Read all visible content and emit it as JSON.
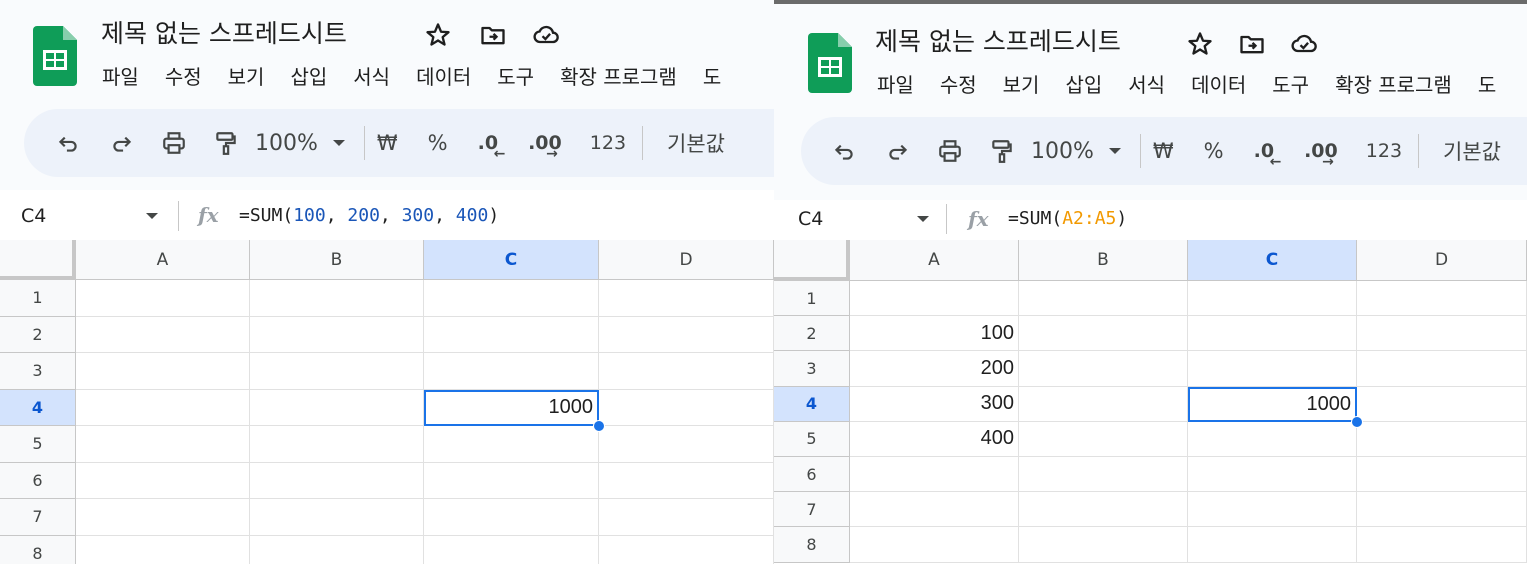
{
  "panels": [
    {
      "title": "제목 없는 스프레드시트",
      "menu": [
        "파일",
        "수정",
        "보기",
        "삽입",
        "서식",
        "데이터",
        "도구",
        "확장 프로그램",
        "도"
      ],
      "toolbar": {
        "zoom": "100%",
        "currency": "₩",
        "percent": "%",
        "decrease_decimal": ".0",
        "increase_decimal": ".00",
        "number_format": "123",
        "font": "기본값"
      },
      "name_box": "C4",
      "formula": {
        "prefix": "=SUM(",
        "args": [
          "100",
          "200",
          "300",
          "400"
        ],
        "suffix": ")"
      },
      "columns": [
        "A",
        "B",
        "C",
        "D"
      ],
      "rows": [
        "1",
        "2",
        "3",
        "4",
        "5",
        "6",
        "7",
        "8"
      ],
      "selected_cell": "C4",
      "cells": {
        "C4": "1000"
      }
    },
    {
      "title": "제목 없는 스프레드시트",
      "menu": [
        "파일",
        "수정",
        "보기",
        "삽입",
        "서식",
        "데이터",
        "도구",
        "확장 프로그램",
        "도"
      ],
      "toolbar": {
        "zoom": "100%",
        "currency": "₩",
        "percent": "%",
        "decrease_decimal": ".0",
        "increase_decimal": ".00",
        "number_format": "123",
        "font": "기본값"
      },
      "name_box": "C4",
      "formula": {
        "prefix": "=SUM(",
        "range": "A2:A5",
        "suffix": ")"
      },
      "columns": [
        "A",
        "B",
        "C",
        "D"
      ],
      "rows": [
        "1",
        "2",
        "3",
        "4",
        "5",
        "6",
        "7",
        "8"
      ],
      "selected_cell": "C4",
      "cells": {
        "A2": "100",
        "A3": "200",
        "A4": "300",
        "A5": "400",
        "C4": "1000"
      }
    }
  ],
  "colors": {
    "sheets_green": "#0f9d58",
    "selection_blue": "#1a73e8",
    "range_orange": "#f29900",
    "number_blue": "#1a56b8"
  }
}
